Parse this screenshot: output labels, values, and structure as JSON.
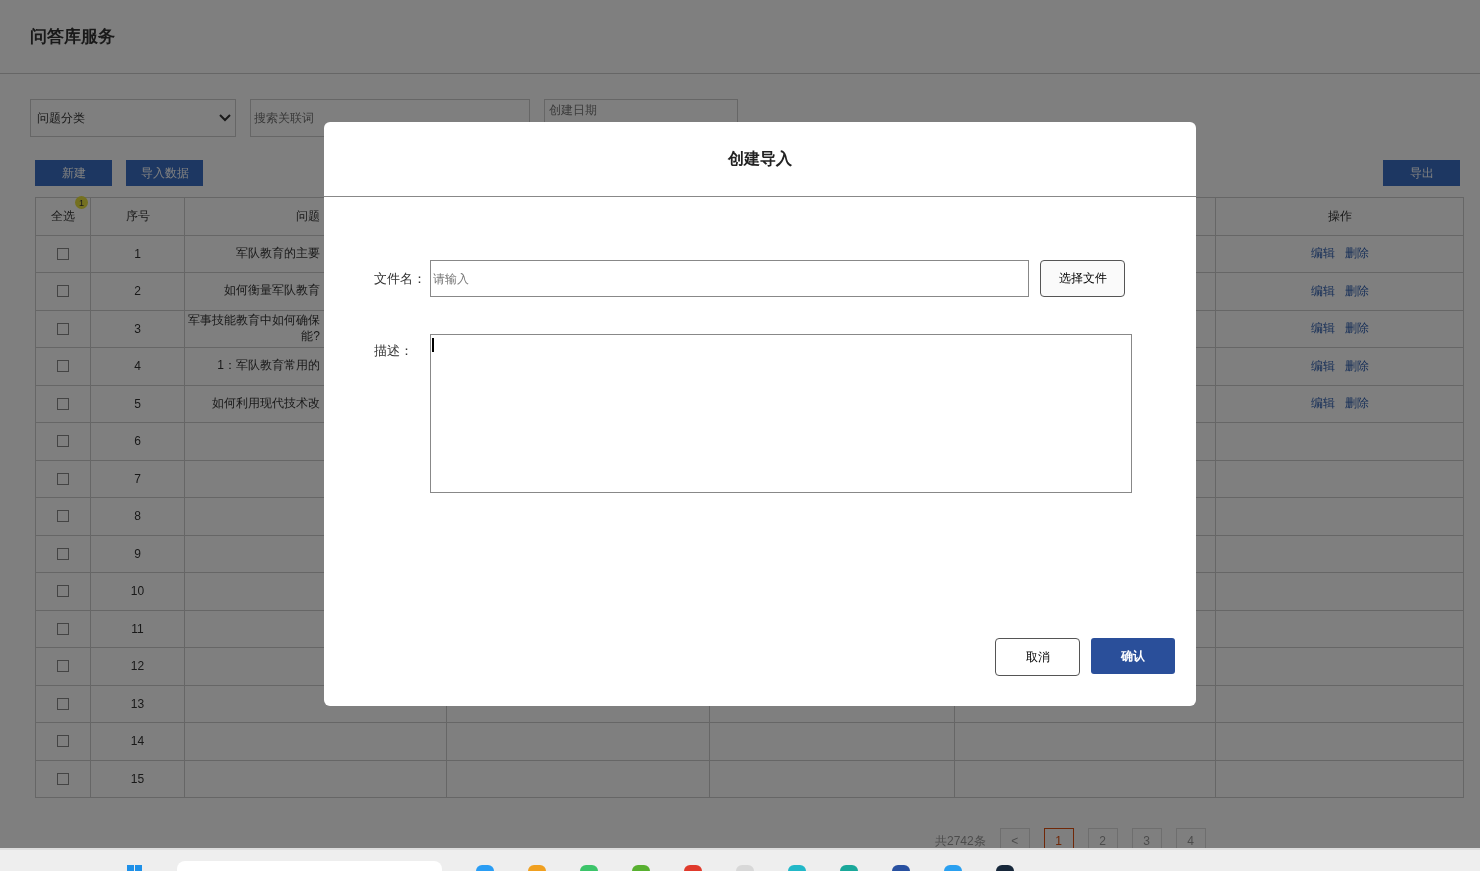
{
  "page_title": "问答库服务",
  "filters": {
    "category": {
      "value": "问题分类"
    },
    "search": {
      "placeholder": "搜索关联词"
    },
    "date": {
      "placeholder": "创建日期"
    }
  },
  "toolbar": {
    "left_buttons": [
      "新建",
      "导入数据"
    ],
    "right_buttons": [
      "导出"
    ]
  },
  "table": {
    "columns": [
      "全选",
      "序号",
      "问题",
      "操作"
    ],
    "select_all_badge": "1",
    "rows": [
      {
        "checked": false,
        "index": "1",
        "question": "军队教育的主要",
        "actions": [
          "编辑",
          "删除"
        ]
      },
      {
        "checked": false,
        "index": "2",
        "question": "如何衡量军队教育",
        "actions": [
          "编辑",
          "删除"
        ]
      },
      {
        "checked": false,
        "index": "3",
        "question": "军事技能教育中如何确保",
        "question_more": "能?",
        "actions": [
          "编辑",
          "删除"
        ]
      },
      {
        "checked": false,
        "index": "4",
        "question": "1：军队教育常用的",
        "actions": [
          "编辑",
          "删除"
        ]
      },
      {
        "checked": false,
        "index": "5",
        "question": "如何利用现代技术改",
        "actions": [
          "编辑",
          "删除"
        ]
      },
      {
        "checked": false,
        "index": "6"
      },
      {
        "checked": false,
        "index": "7"
      },
      {
        "checked": false,
        "index": "8"
      },
      {
        "checked": false,
        "index": "9"
      },
      {
        "checked": false,
        "index": "10"
      },
      {
        "checked": false,
        "index": "11"
      },
      {
        "checked": false,
        "index": "12"
      },
      {
        "checked": false,
        "index": "13"
      },
      {
        "checked": false,
        "index": "14"
      },
      {
        "checked": false,
        "index": "15"
      }
    ]
  },
  "pagination": {
    "total": "共2742条",
    "prev": "<",
    "pages": [
      {
        "label": "1",
        "selected": true
      },
      {
        "label": "2",
        "selected": false
      },
      {
        "label": "3",
        "selected": false
      },
      {
        "label": "4",
        "selected": false
      }
    ]
  },
  "dialog": {
    "title": "创建导入",
    "file_label": "文件名：",
    "file_placeholder": "请输入",
    "choose_button": "选择文件",
    "desc_label": "描述：",
    "cancel": "取消",
    "confirm": "确认"
  }
}
